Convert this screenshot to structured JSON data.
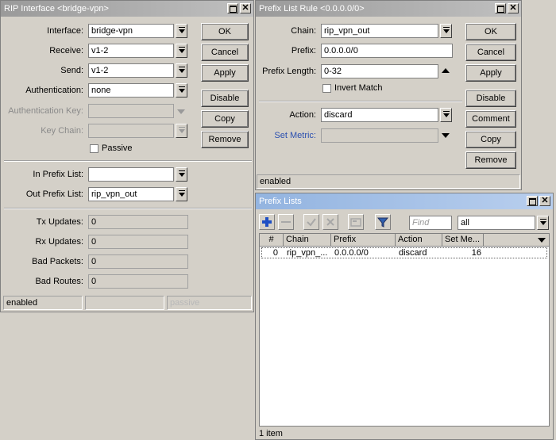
{
  "rip_window": {
    "title": "RIP Interface <bridge-vpn>",
    "labels": {
      "interface": "Interface:",
      "receive": "Receive:",
      "send": "Send:",
      "authentication": "Authentication:",
      "authentication_key": "Authentication Key:",
      "key_chain": "Key Chain:",
      "in_prefix_list": "In Prefix List:",
      "out_prefix_list": "Out Prefix List:",
      "tx_updates": "Tx Updates:",
      "rx_updates": "Rx Updates:",
      "bad_packets": "Bad Packets:",
      "bad_routes": "Bad Routes:"
    },
    "values": {
      "interface": "bridge-vpn",
      "receive": "v1-2",
      "send": "v1-2",
      "authentication": "none",
      "authentication_key": "",
      "key_chain": "",
      "in_prefix_list": "",
      "out_prefix_list": "rip_vpn_out",
      "tx_updates": "0",
      "rx_updates": "0",
      "bad_packets": "0",
      "bad_routes": "0"
    },
    "passive_label": "Passive",
    "buttons": {
      "ok": "OK",
      "cancel": "Cancel",
      "apply": "Apply",
      "disable": "Disable",
      "copy": "Copy",
      "remove": "Remove"
    },
    "status": {
      "state": "enabled",
      "middle": "",
      "passive": "passive"
    }
  },
  "rule_window": {
    "title": "Prefix List Rule <0.0.0.0/0>",
    "labels": {
      "chain": "Chain:",
      "prefix": "Prefix:",
      "prefix_length": "Prefix Length:",
      "action": "Action:",
      "set_metric": "Set Metric:"
    },
    "values": {
      "chain": "rip_vpn_out",
      "prefix": "0.0.0.0/0",
      "prefix_length": "0-32",
      "action": "discard",
      "set_metric": ""
    },
    "invert_match_label": "Invert Match",
    "buttons": {
      "ok": "OK",
      "cancel": "Cancel",
      "apply": "Apply",
      "disable": "Disable",
      "comment": "Comment",
      "copy": "Copy",
      "remove": "Remove"
    },
    "status": "enabled"
  },
  "lists_window": {
    "title": "Prefix Lists",
    "find_placeholder": "Find",
    "filter_value": "all",
    "columns": [
      "#",
      "Chain",
      "Prefix",
      "Action",
      "Set Me..."
    ],
    "rows": [
      {
        "num": "0",
        "chain": "rip_vpn_...",
        "prefix": "0.0.0.0/0",
        "action": "discard",
        "set_metric": "16"
      }
    ],
    "status": "1 item"
  },
  "colors": {
    "face": "#d4d0c8",
    "active_title": "#93b4e0",
    "inactive_title": "#a8a8a8",
    "add_icon": "#1e4fc4"
  }
}
